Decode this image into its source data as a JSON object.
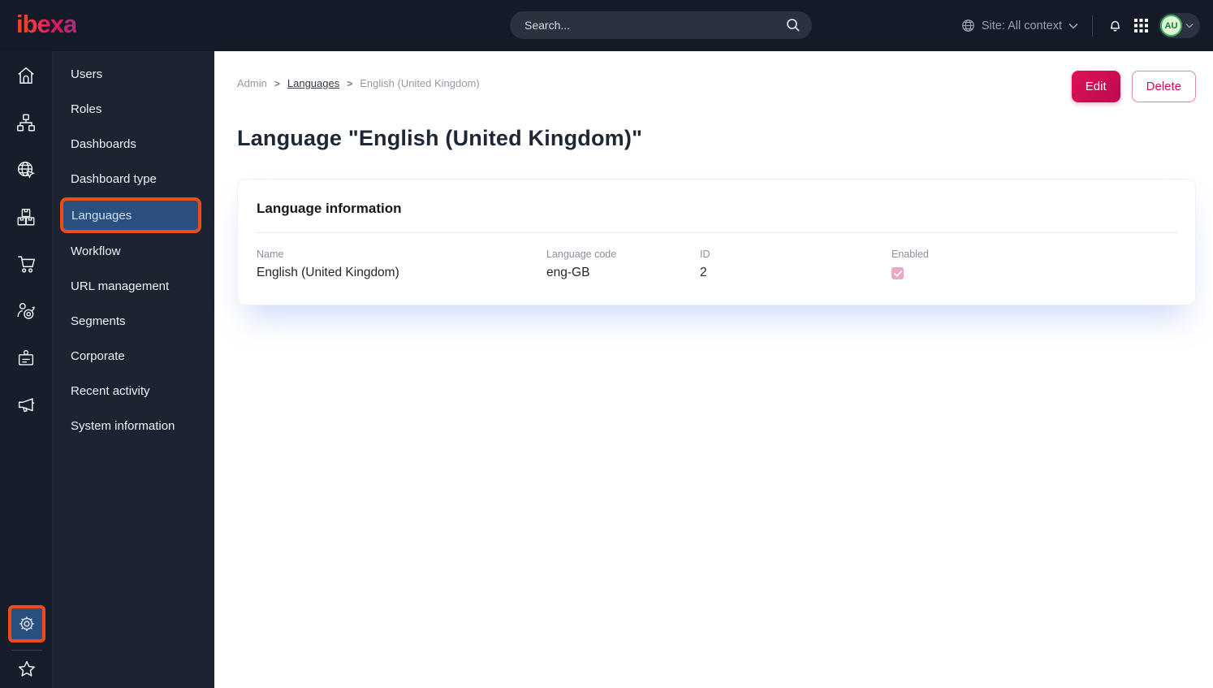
{
  "topbar": {
    "logo": "ibexa",
    "search_placeholder": "Search...",
    "site_context": "Site: All context",
    "avatar_initials": "AU"
  },
  "icon_rail": {
    "items": [
      "home",
      "content-structure",
      "site",
      "products",
      "commerce",
      "customers",
      "corporate",
      "marketing"
    ],
    "bottom": [
      "settings",
      "bookmarks"
    ],
    "active_item": "settings"
  },
  "sidebar": {
    "items": [
      {
        "label": "Users",
        "active": false
      },
      {
        "label": "Roles",
        "active": false
      },
      {
        "label": "Dashboards",
        "active": false
      },
      {
        "label": "Dashboard type",
        "active": false
      },
      {
        "label": "Languages",
        "active": true
      },
      {
        "label": "Workflow",
        "active": false
      },
      {
        "label": "URL management",
        "active": false
      },
      {
        "label": "Segments",
        "active": false
      },
      {
        "label": "Corporate",
        "active": false
      },
      {
        "label": "Recent activity",
        "active": false
      },
      {
        "label": "System information",
        "active": false
      }
    ]
  },
  "breadcrumb": {
    "separator": ">",
    "items": [
      {
        "label": "Admin",
        "link": false
      },
      {
        "label": "Languages",
        "link": true
      },
      {
        "label": "English (United Kingdom)",
        "link": false
      }
    ]
  },
  "actions": {
    "edit_label": "Edit",
    "delete_label": "Delete"
  },
  "page": {
    "title": "Language \"English (United Kingdom)\""
  },
  "card": {
    "heading": "Language information",
    "fields": [
      {
        "label": "Name",
        "value": "English (United Kingdom)"
      },
      {
        "label": "Language code",
        "value": "eng-GB"
      },
      {
        "label": "ID",
        "value": "2"
      },
      {
        "label": "Enabled",
        "checked": true
      }
    ]
  },
  "colors": {
    "accent_pink": "#d60b53",
    "highlight_orange": "#ee4c1b",
    "selected_blue": "#2a5080",
    "topbar_bg": "#141a28",
    "rail_bg": "#161d2b",
    "sidebar_bg": "#1c2432",
    "avatar_green": "#3fb64b",
    "checkbox_pink": "#eba6c8"
  }
}
